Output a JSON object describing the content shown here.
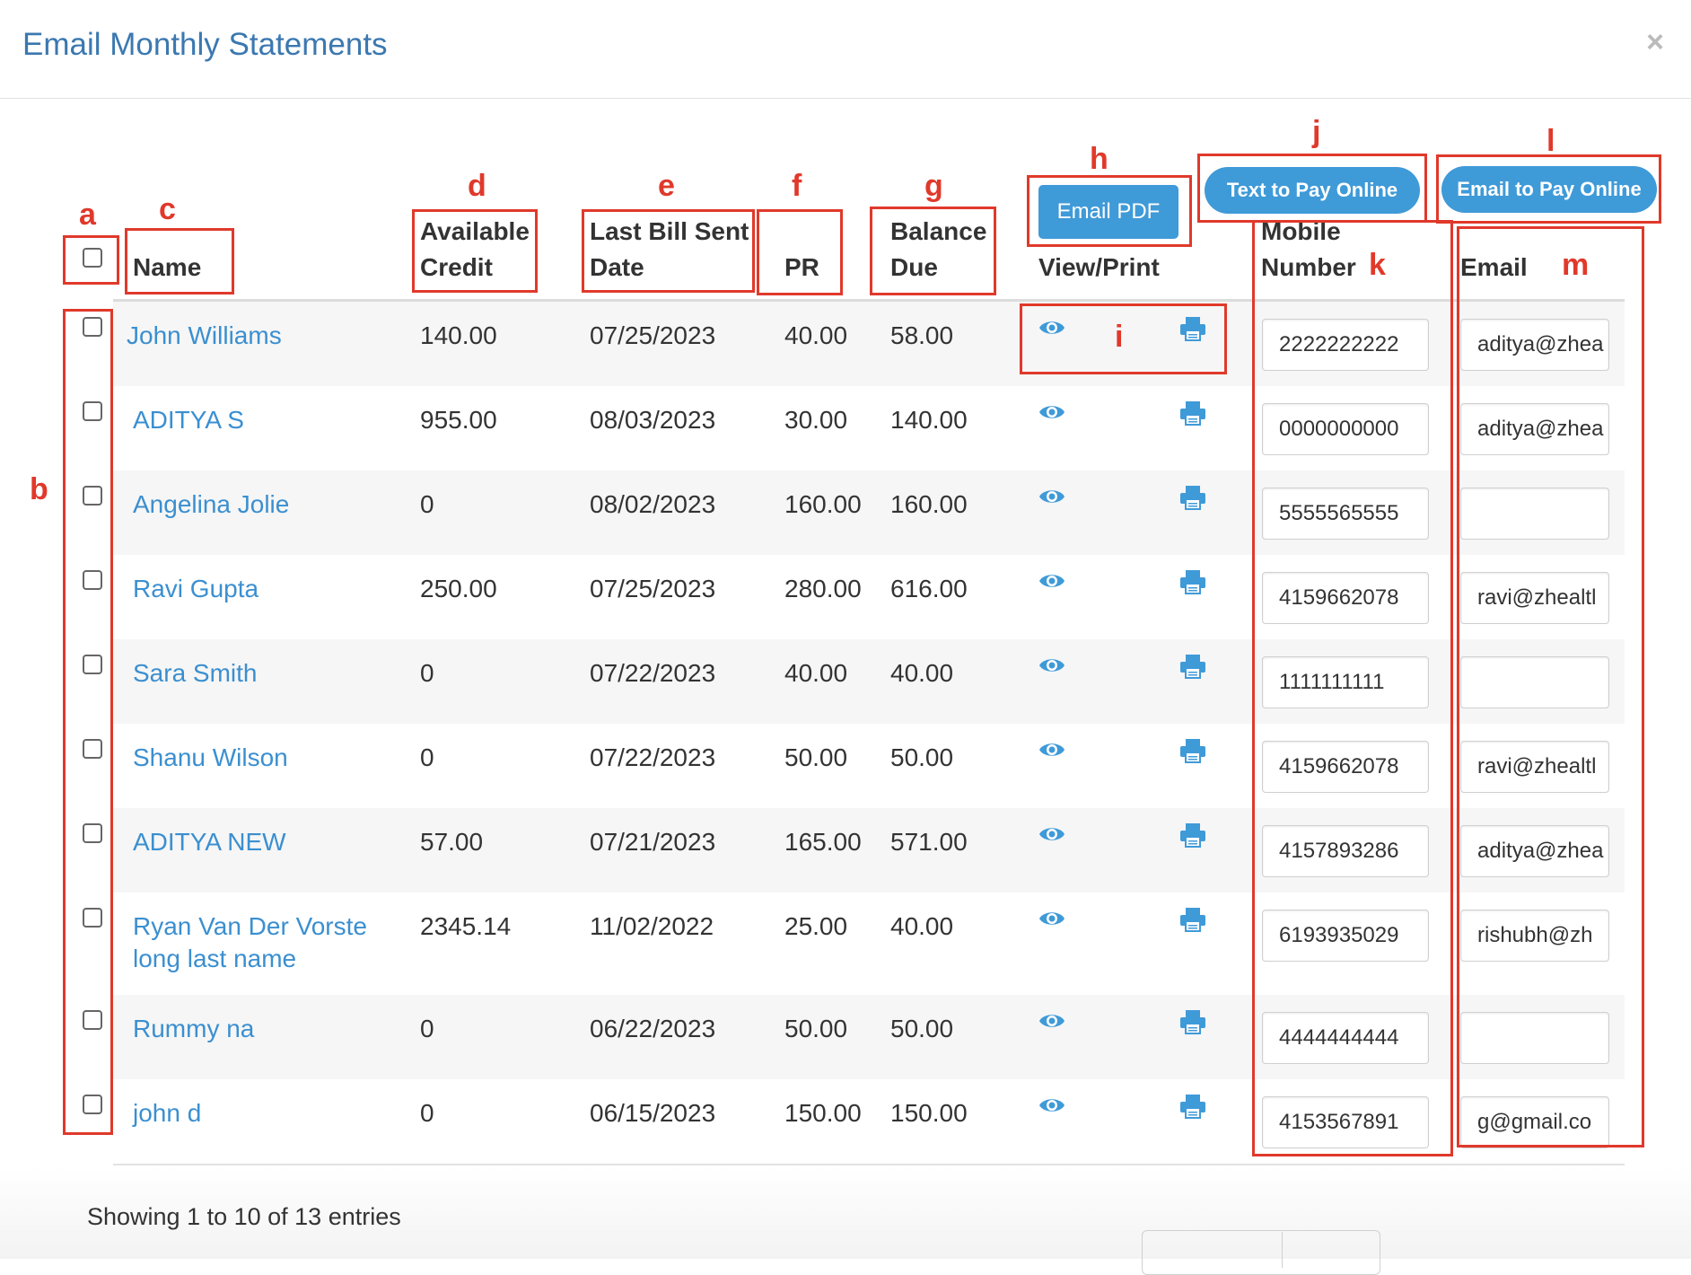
{
  "modal": {
    "title": "Email Monthly Statements",
    "close": "×"
  },
  "headers": {
    "name": "Name",
    "available_credit": [
      "Available",
      "Credit"
    ],
    "last_bill_sent": [
      "Last Bill Sent",
      "Date"
    ],
    "pr": "PR",
    "balance_due": [
      "Balance",
      "Due"
    ],
    "view_print": "View/Print",
    "mobile": [
      "Mobile",
      "Number"
    ],
    "email": "Email"
  },
  "buttons": {
    "email_pdf": "Email PDF",
    "text_to_pay": "Text to Pay Online",
    "email_to_pay": "Email to Pay Online"
  },
  "rows": [
    {
      "name": "John Williams",
      "credit": "140.00",
      "date": "07/25/2023",
      "pr": "40.00",
      "due": "58.00",
      "mobile": "2222222222",
      "email": "aditya@zhea"
    },
    {
      "name": "ADITYA S",
      "credit": "955.00",
      "date": "08/03/2023",
      "pr": "30.00",
      "due": "140.00",
      "mobile": "0000000000",
      "email": "aditya@zhea"
    },
    {
      "name": "Angelina Jolie",
      "credit": "0",
      "date": "08/02/2023",
      "pr": "160.00",
      "due": "160.00",
      "mobile": "5555565555",
      "email": ""
    },
    {
      "name": "Ravi Gupta",
      "credit": "250.00",
      "date": "07/25/2023",
      "pr": "280.00",
      "due": "616.00",
      "mobile": "4159662078",
      "email": "ravi@zhealtl"
    },
    {
      "name": "Sara Smith",
      "credit": "0",
      "date": "07/22/2023",
      "pr": "40.00",
      "due": "40.00",
      "mobile": "1111111111",
      "email": ""
    },
    {
      "name": "Shanu Wilson",
      "credit": "0",
      "date": "07/22/2023",
      "pr": "50.00",
      "due": "50.00",
      "mobile": "4159662078",
      "email": "ravi@zhealtl"
    },
    {
      "name": "ADITYA NEW",
      "credit": "57.00",
      "date": "07/21/2023",
      "pr": "165.00",
      "due": "571.00",
      "mobile": "4157893286",
      "email": "aditya@zhea"
    },
    {
      "name": "Ryan Van Der Vorste long last name",
      "credit": "2345.14",
      "date": "11/02/2022",
      "pr": "25.00",
      "due": "40.00",
      "mobile": "6193935029",
      "email": "rishubh@zh"
    },
    {
      "name": "Rummy na",
      "credit": "0",
      "date": "06/22/2023",
      "pr": "50.00",
      "due": "50.00",
      "mobile": "4444444444",
      "email": ""
    },
    {
      "name": "john d",
      "credit": "0",
      "date": "06/15/2023",
      "pr": "150.00",
      "due": "150.00",
      "mobile": "4153567891",
      "email": "g@gmail.co"
    }
  ],
  "footer": {
    "info": "Showing 1 to 10 of 13 entries"
  },
  "annotations": {
    "a": "a",
    "b": "b",
    "c": "c",
    "d": "d",
    "e": "e",
    "f": "f",
    "g": "g",
    "h": "h",
    "i": "i",
    "j": "j",
    "k": "k",
    "l": "l",
    "m": "m"
  },
  "colors": {
    "accent": "#3f9ad8",
    "link": "#3b8fd0",
    "annotation": "#e0392b",
    "title": "#3b78b0"
  }
}
